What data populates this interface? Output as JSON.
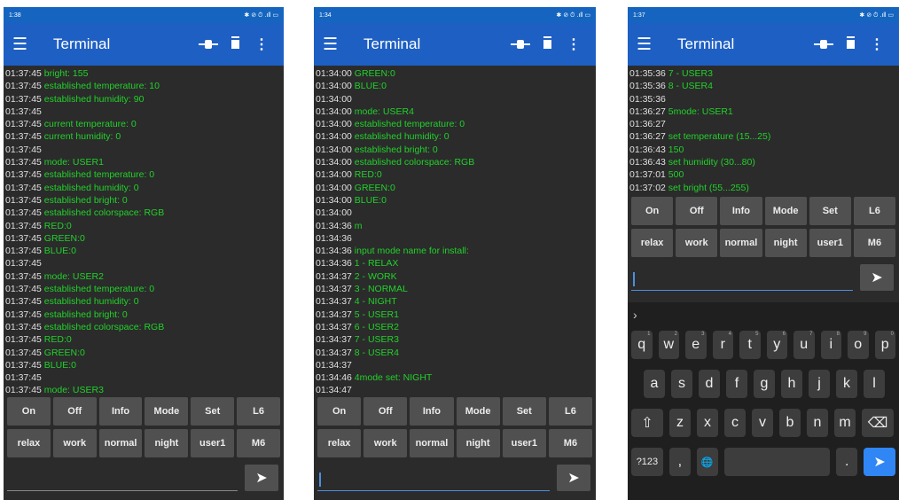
{
  "app": {
    "title": "Terminal",
    "icons": [
      "menu-icon",
      "connect-icon",
      "trash-icon",
      "overflow-dots-icon"
    ],
    "colors": {
      "appbar": "#1e5fc3",
      "message": "#21d12a",
      "timestamp": "#e0e0e0",
      "button": "#505050",
      "enter_key": "#2f86f4"
    }
  },
  "screens": [
    {
      "status": {
        "time": "1:38",
        "icons": "✱ ⊘ ⏱ .ıll ▭"
      },
      "log": [
        {
          "t": "01:37:45",
          "m": "bright: 155"
        },
        {
          "t": "01:37:45",
          "m": "established temperature: 10"
        },
        {
          "t": "01:37:45",
          "m": "established humidity: 90"
        },
        {
          "t": "01:37:45",
          "m": ""
        },
        {
          "t": "01:37:45",
          "m": "current temperature: 0"
        },
        {
          "t": "01:37:45",
          "m": "current humidity: 0"
        },
        {
          "t": "01:37:45",
          "m": ""
        },
        {
          "t": "01:37:45",
          "m": "mode: USER1"
        },
        {
          "t": "01:37:45",
          "m": "established temperature: 0"
        },
        {
          "t": "01:37:45",
          "m": "established humidity: 0"
        },
        {
          "t": "01:37:45",
          "m": "established bright: 0"
        },
        {
          "t": "01:37:45",
          "m": "established colorspace: RGB"
        },
        {
          "t": "01:37:45",
          "m": "RED:0"
        },
        {
          "t": "01:37:45",
          "m": "GREEN:0"
        },
        {
          "t": "01:37:45",
          "m": "BLUE:0"
        },
        {
          "t": "01:37:45",
          "m": ""
        },
        {
          "t": "01:37:45",
          "m": "mode: USER2"
        },
        {
          "t": "01:37:45",
          "m": "established temperature: 0"
        },
        {
          "t": "01:37:45",
          "m": "established humidity: 0"
        },
        {
          "t": "01:37:45",
          "m": "established bright: 0"
        },
        {
          "t": "01:37:45",
          "m": "established colorspace: RGB"
        },
        {
          "t": "01:37:45",
          "m": "RED:0"
        },
        {
          "t": "01:37:45",
          "m": "GREEN:0"
        },
        {
          "t": "01:37:45",
          "m": "BLUE:0"
        },
        {
          "t": "01:37:45",
          "m": ""
        },
        {
          "t": "01:37:45",
          "m": "mode: USER3"
        }
      ],
      "buttons_row1": [
        "On",
        "Off",
        "Info",
        "Mode",
        "Set",
        "L6"
      ],
      "buttons_row2": [
        "relax",
        "work",
        "normal",
        "night",
        "user1",
        "M6"
      ],
      "input_value": ""
    },
    {
      "status": {
        "time": "1:34",
        "icons": "✱ ⊘ ⏱ .ıll ▭"
      },
      "log": [
        {
          "t": "01:34:00",
          "m": "GREEN:0"
        },
        {
          "t": "01:34:00",
          "m": "BLUE:0"
        },
        {
          "t": "01:34:00",
          "m": ""
        },
        {
          "t": "01:34:00",
          "m": "mode: USER4"
        },
        {
          "t": "01:34:00",
          "m": "established temperature: 0"
        },
        {
          "t": "01:34:00",
          "m": "established humidity: 0"
        },
        {
          "t": "01:34:00",
          "m": "established bright: 0"
        },
        {
          "t": "01:34:00",
          "m": "established colorspace: RGB"
        },
        {
          "t": "01:34:00",
          "m": "RED:0"
        },
        {
          "t": "01:34:00",
          "m": "GREEN:0"
        },
        {
          "t": "01:34:00",
          "m": "BLUE:0"
        },
        {
          "t": "01:34:00",
          "m": ""
        },
        {
          "t": "01:34:36",
          "m": "m"
        },
        {
          "t": "01:34:36",
          "m": ""
        },
        {
          "t": "01:34:36",
          "m": "input mode name for install:"
        },
        {
          "t": "01:34:36",
          "m": "1 - RELAX"
        },
        {
          "t": "01:34:37",
          "m": "2 - WORK"
        },
        {
          "t": "01:34:37",
          "m": "3 - NORMAL"
        },
        {
          "t": "01:34:37",
          "m": "4 - NIGHT"
        },
        {
          "t": "01:34:37",
          "m": "5 - USER1"
        },
        {
          "t": "01:34:37",
          "m": "6 - USER2"
        },
        {
          "t": "01:34:37",
          "m": "7 - USER3"
        },
        {
          "t": "01:34:37",
          "m": "8 - USER4"
        },
        {
          "t": "01:34:37",
          "m": ""
        },
        {
          "t": "01:34:46",
          "m": "4mode set: NIGHT"
        },
        {
          "t": "01:34:47",
          "m": ""
        }
      ],
      "buttons_row1": [
        "On",
        "Off",
        "Info",
        "Mode",
        "Set",
        "L6"
      ],
      "buttons_row2": [
        "relax",
        "work",
        "normal",
        "night",
        "user1",
        "M6"
      ],
      "input_value": ""
    },
    {
      "status": {
        "time": "1:37",
        "icons": "✱ ⊘ ⏱ .ıll ▭"
      },
      "log": [
        {
          "t": "01:35:36",
          "m": "7 - USER3"
        },
        {
          "t": "01:35:36",
          "m": "8 - USER4"
        },
        {
          "t": "01:35:36",
          "m": ""
        },
        {
          "t": "01:36:27",
          "m": "5mode: USER1"
        },
        {
          "t": "01:36:27",
          "m": ""
        },
        {
          "t": "01:36:27",
          "m": "set temperature (15...25)"
        },
        {
          "t": "01:36:43",
          "m": "150"
        },
        {
          "t": "01:36:43",
          "m": "set humidity (30...80)"
        },
        {
          "t": "01:37:01",
          "m": "500"
        },
        {
          "t": "01:37:02",
          "m": "set bright (55...255)"
        }
      ],
      "buttons_row1": [
        "On",
        "Off",
        "Info",
        "Mode",
        "Set",
        "L6"
      ],
      "buttons_row2": [
        "relax",
        "work",
        "normal",
        "night",
        "user1",
        "M6"
      ],
      "input_value": "",
      "keyboard": {
        "suggestion_toggle": "›",
        "row1": [
          [
            "q",
            "1"
          ],
          [
            "w",
            "2"
          ],
          [
            "e",
            "3"
          ],
          [
            "r",
            "4"
          ],
          [
            "t",
            "5"
          ],
          [
            "y",
            "6"
          ],
          [
            "u",
            "7"
          ],
          [
            "i",
            "8"
          ],
          [
            "o",
            "9"
          ],
          [
            "p",
            "0"
          ]
        ],
        "row2": [
          "a",
          "s",
          "d",
          "f",
          "g",
          "h",
          "j",
          "k",
          "l"
        ],
        "row3": [
          "z",
          "x",
          "c",
          "v",
          "b",
          "n",
          "m"
        ],
        "shift": "⇧",
        "backspace": "⌫",
        "symbols": "?123",
        "comma": ",",
        "globe": "🌐",
        "period": ".",
        "enter": "➤"
      }
    }
  ]
}
